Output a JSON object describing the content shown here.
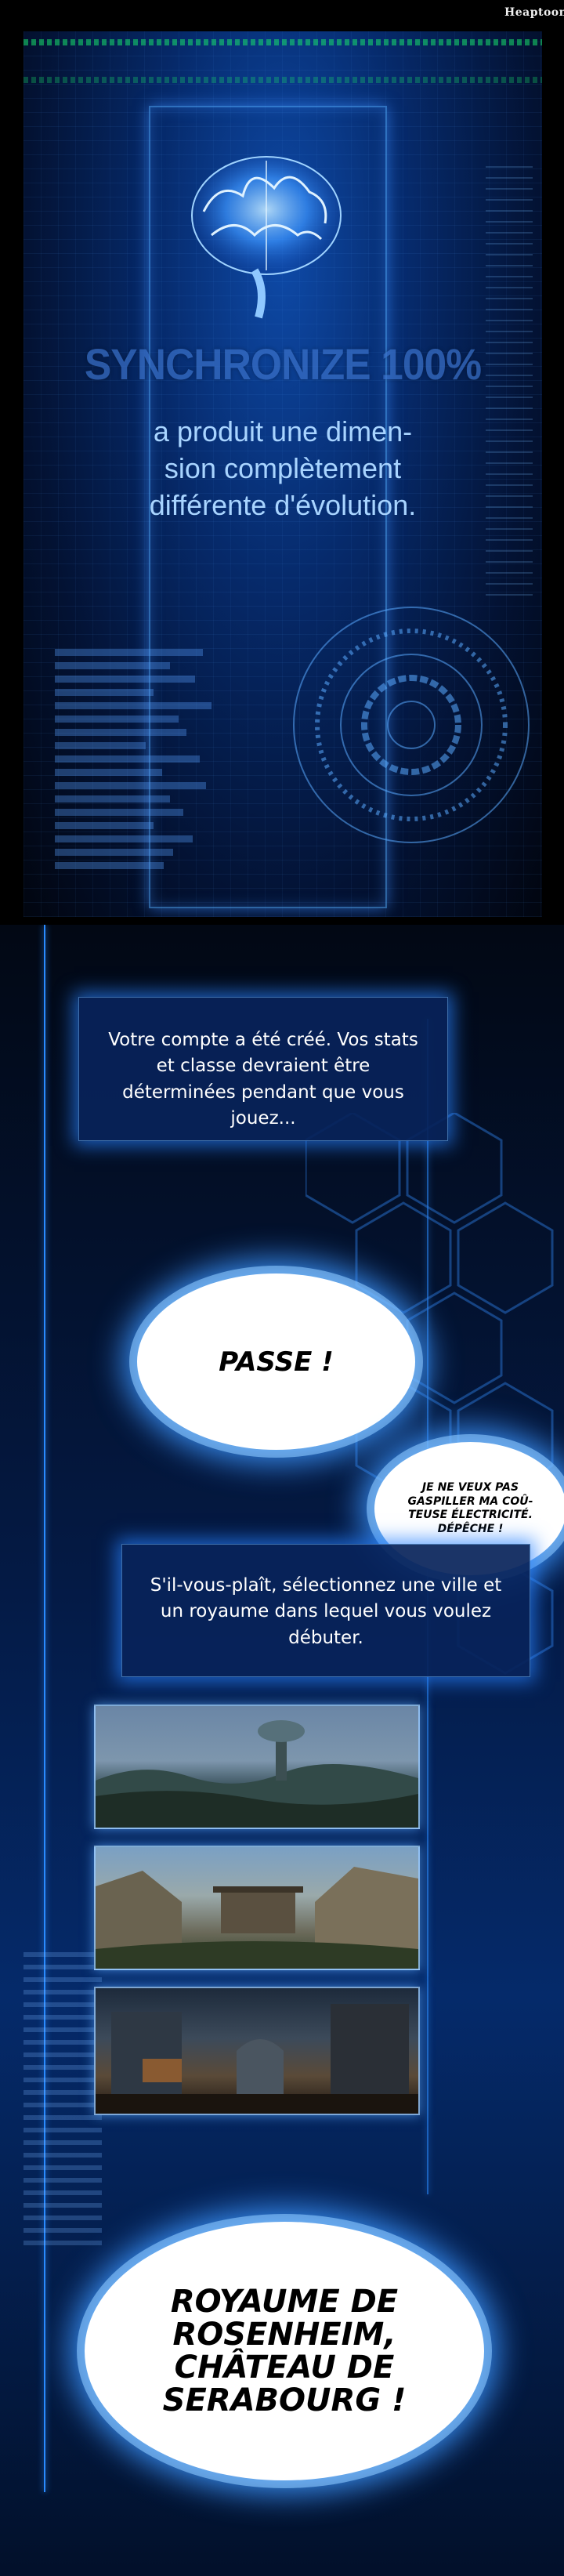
{
  "watermark": "Heaptoon",
  "top_panel": {
    "title": "SYNCHRONIZE 100%",
    "lines": [
      "a produit une dimen-",
      "sion complètement",
      "différente d'évolution."
    ]
  },
  "dialog_1": "Votre compte a été créé. Vos stats et classe devraient être déterminées pendant que vous jouez...",
  "bubble_pass": "PASSE !",
  "bubble_small": "JE NE VEUX PAS GASPILLER MA COÛ-TEUSE ÉLECTRICITÉ. DÉPÊCHE !",
  "dialog_2": "S'il-vous-plaît, sélectionnez une ville et un royaume dans lequel vous voulez débuter.",
  "bubble_final": "ROYAUME DE ROSENHEIM, CHÂTEAU DE SERABOURG !",
  "colors": {
    "accent": "#2a8bff",
    "panel": "#08235a",
    "bubble": "#ffffff"
  }
}
